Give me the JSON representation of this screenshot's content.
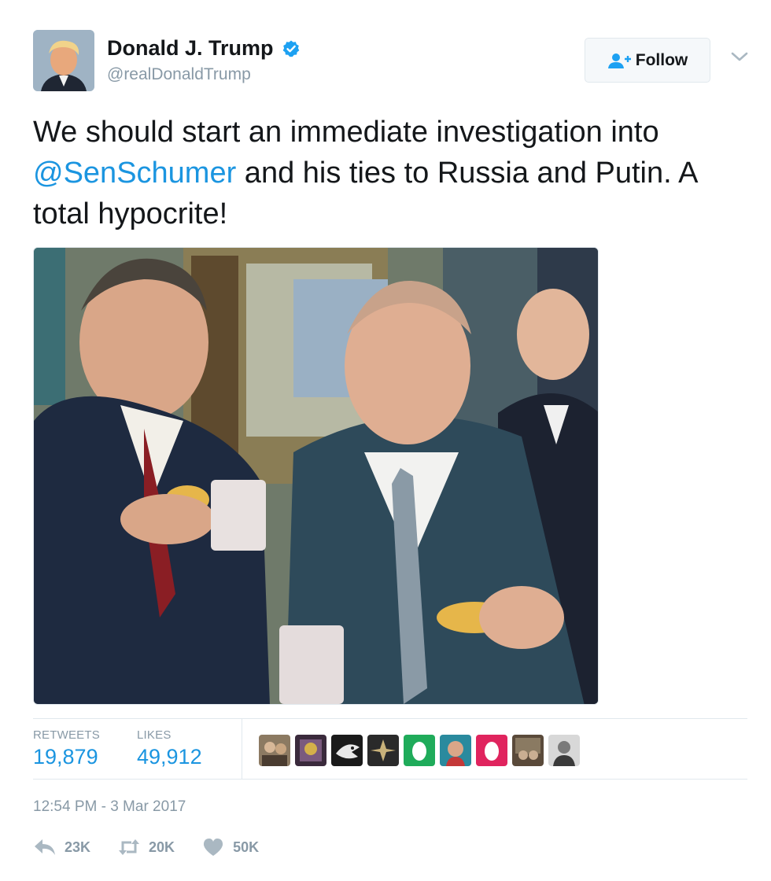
{
  "user": {
    "display_name": "Donald J. Trump",
    "handle": "@realDonaldTrump",
    "verified": true
  },
  "follow_button": {
    "label": "Follow"
  },
  "tweet": {
    "text_part1": "We should start an immediate investigation into ",
    "mention": "@SenSchumer",
    "text_part2": " and his ties to Russia and Putin. A total hypocrite!"
  },
  "stats": {
    "retweets_label": "RETWEETS",
    "retweets_value": "19,879",
    "likes_label": "LIKES",
    "likes_value": "49,912"
  },
  "timestamp": "12:54 PM - 3 Mar 2017",
  "actions": {
    "reply_count": "23K",
    "retweet_count": "20K",
    "like_count": "50K"
  },
  "icons": {
    "verified": "verified-badge-icon",
    "follow": "add-user-icon",
    "more": "chevron-down-icon",
    "reply": "reply-icon",
    "retweet": "retweet-icon",
    "like": "heart-icon"
  },
  "colors": {
    "accent": "#1b95e0",
    "muted": "#8899a6",
    "text": "#14171a",
    "border": "#e1e8ed"
  }
}
